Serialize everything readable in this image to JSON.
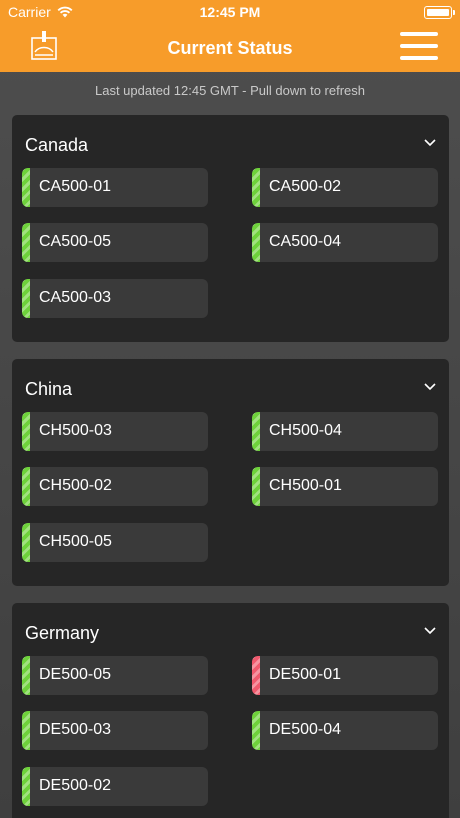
{
  "status_bar": {
    "carrier": "Carrier",
    "time": "12:45 PM"
  },
  "header": {
    "title": "Current Status"
  },
  "updated_text": "Last updated 12:45 GMT - Pull down to refresh",
  "colors": {
    "header": "#f79c2a",
    "ok": "#6ed13b",
    "alert": "#f05a6e"
  },
  "groups": [
    {
      "name": "Canada",
      "items": [
        {
          "id": "CA500-01",
          "status": "ok"
        },
        {
          "id": "CA500-02",
          "status": "ok"
        },
        {
          "id": "CA500-05",
          "status": "ok"
        },
        {
          "id": "CA500-04",
          "status": "ok"
        },
        {
          "id": "CA500-03",
          "status": "ok"
        }
      ]
    },
    {
      "name": "China",
      "items": [
        {
          "id": "CH500-03",
          "status": "ok"
        },
        {
          "id": "CH500-04",
          "status": "ok"
        },
        {
          "id": "CH500-02",
          "status": "ok"
        },
        {
          "id": "CH500-01",
          "status": "ok"
        },
        {
          "id": "CH500-05",
          "status": "ok"
        }
      ]
    },
    {
      "name": "Germany",
      "items": [
        {
          "id": "DE500-05",
          "status": "ok"
        },
        {
          "id": "DE500-01",
          "status": "alert"
        },
        {
          "id": "DE500-03",
          "status": "ok"
        },
        {
          "id": "DE500-04",
          "status": "ok"
        },
        {
          "id": "DE500-02",
          "status": "ok"
        }
      ]
    }
  ]
}
